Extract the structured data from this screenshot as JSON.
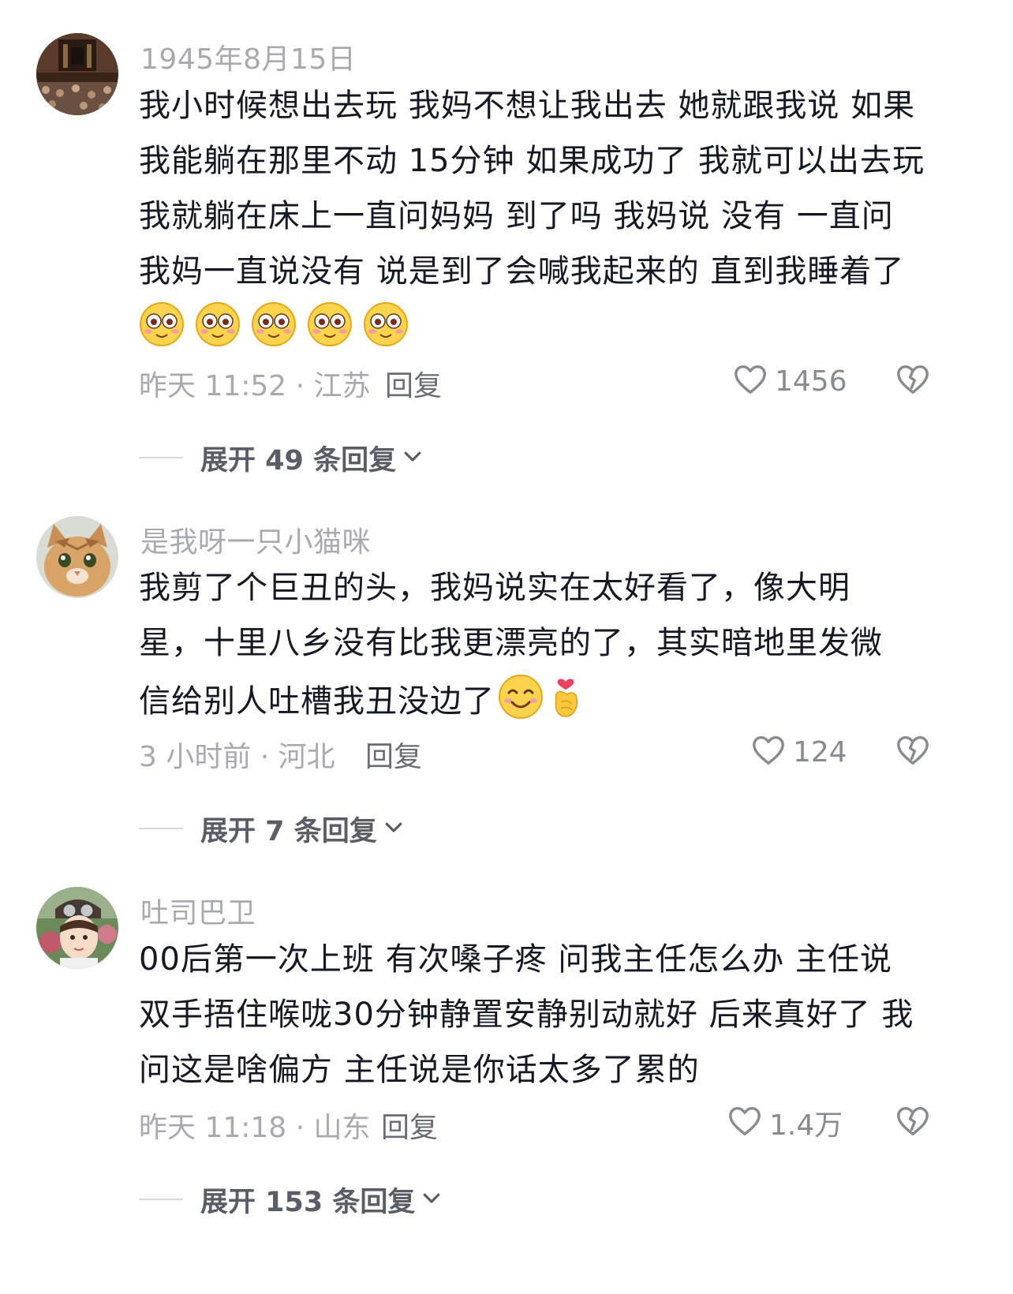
{
  "comments": [
    {
      "username": "1945年8月15日",
      "lines": [
        "我小时候想出去玩 我妈不想让我出去 她就跟我说 如果",
        "我能躺在那里不动 15分钟 如果成功了 我就可以出去玩",
        "我就躺在床上一直问妈妈 到了吗 我妈说 没有 一直问",
        "我妈一直说没有 说是到了会喊我起来的 直到我睡着了"
      ],
      "emoji_icons": [
        "wide-eyed-face-icon",
        "wide-eyed-face-icon",
        "wide-eyed-face-icon",
        "wide-eyed-face-icon",
        "wide-eyed-face-icon"
      ],
      "meta": "昨天 11:52 · 江苏",
      "reply_label": "回复",
      "like_count": "1456",
      "expand_label": "展开 49 条回复"
    },
    {
      "username": "是我呀一只小猫咪",
      "lines": [
        "我剪了个巨丑的头，我妈说实在太好看了，像大明",
        "星，十里八乡没有比我更漂亮的了，其实暗地里发微",
        "信给别人吐槽我丑没边了"
      ],
      "emoji_icons": [
        "smiling-face-icon",
        "finger-heart-icon"
      ],
      "meta": "3 小时前 · 河北",
      "reply_label": "回复",
      "like_count": "124",
      "expand_label": "展开 7 条回复"
    },
    {
      "username": "吐司巴卫",
      "lines": [
        "00后第一次上班 有次嗓子疼 问我主任怎么办 主任说",
        "双手捂住喉咙30分钟静置安静别动就好 后来真好了 我",
        "问这是啥偏方 主任说是你话太多了累的"
      ],
      "emoji_icons": [],
      "meta": "昨天 11:18 · 山东",
      "reply_label": "回复",
      "like_count": "1.4万",
      "expand_label": "展开 153 条回复"
    }
  ],
  "icons": {
    "like": "heart-outline-icon",
    "dislike": "broken-heart-icon",
    "expand": "chevron-down-icon"
  },
  "colors": {
    "text": "#161823",
    "meta": "#a9a9b0",
    "expand": "#5a5c66",
    "emoji_yellow": "#fcd34d"
  }
}
